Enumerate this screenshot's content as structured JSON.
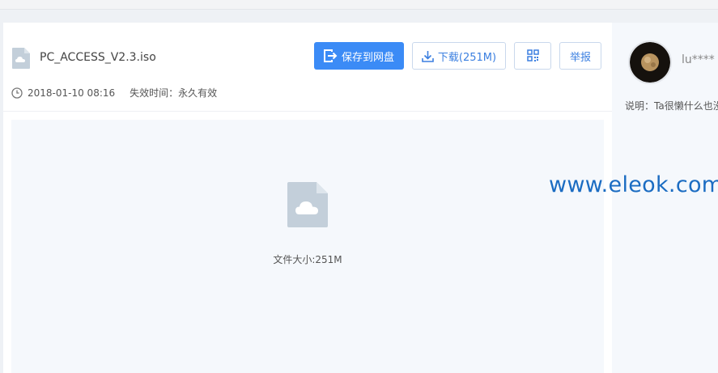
{
  "file": {
    "name": "PC_ACCESS_V2.3.iso",
    "date": "2018-01-10 08:16",
    "expiry_label": "失效时间：永久有效",
    "size_text": "文件大小:251M"
  },
  "actions": {
    "save_label": "保存到网盘",
    "download_label": "下载(251M)",
    "report_label": "举报"
  },
  "user": {
    "name": "lu****",
    "description": "说明：Ta很懒什么也没"
  },
  "watermark": "www.eleok.com",
  "colors": {
    "primary": "#3b8bf6",
    "icon_gray": "#c3cfda",
    "preview_bg": "#f5f8fc",
    "watermark": "#1b6cc2"
  },
  "icons": {
    "file": "cloud-file-icon",
    "save": "save-to-cloud-icon",
    "download": "download-icon",
    "qr": "qr-code-icon",
    "clock": "clock-icon"
  }
}
